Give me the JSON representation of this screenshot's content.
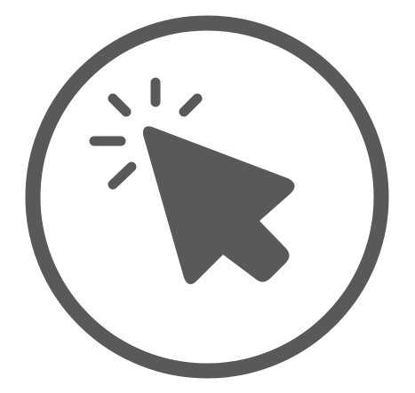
{
  "icon": {
    "name": "click-cursor-icon",
    "color": "#595959",
    "background": "#ffffff"
  }
}
